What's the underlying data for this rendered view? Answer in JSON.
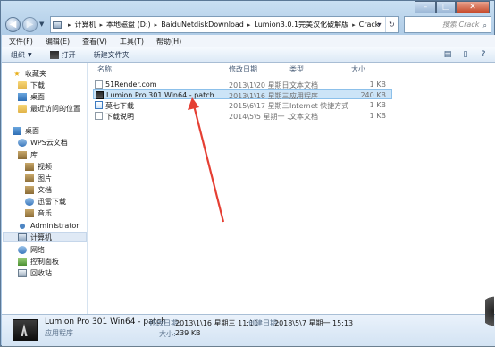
{
  "window": {
    "title_controls": {
      "minimize": "–",
      "maximize": "□",
      "close": "✕"
    }
  },
  "address_bar": {
    "crumbs": [
      "计算机",
      "本地磁盘 (D:)",
      "BaiduNetdiskDownload",
      "Lumion3.0.1完美汉化破解版",
      "Crack"
    ],
    "dropdown": "▾",
    "refresh": "↻"
  },
  "search": {
    "placeholder": "搜索 Crack",
    "icon": "search-icon"
  },
  "menu": [
    "文件(F)",
    "编辑(E)",
    "查看(V)",
    "工具(T)",
    "帮助(H)"
  ],
  "toolbar": {
    "organize": "组织",
    "open": "打开",
    "new_folder": "新建文件夹"
  },
  "nav": {
    "favorites": "收藏夹",
    "downloads": "下载",
    "desktop": "桌面",
    "recent": "最近访问的位置",
    "desktop_root": "桌面",
    "wps": "WPS云文档",
    "library": "库",
    "videos": "视频",
    "pictures": "图片",
    "documents": "文档",
    "xunlei": "迅雷下载",
    "music": "音乐",
    "admin": "Administrator",
    "computer": "计算机",
    "network": "网络",
    "control_panel": "控制面板",
    "recycle_bin": "回收站"
  },
  "columns": {
    "name": "名称",
    "date": "修改日期",
    "type": "类型",
    "size": "大小"
  },
  "files": [
    {
      "name": "51Render.com",
      "date": "2013\\1\\20 星期日 ...",
      "type": "文本文档",
      "size": "1 KB",
      "kind": "doc"
    },
    {
      "name": "Lumion Pro 301 Win64 - patch",
      "date": "2013\\1\\16 星期三 ...",
      "type": "应用程序",
      "size": "240 KB",
      "kind": "exe"
    },
    {
      "name": "莫七下载",
      "date": "2015\\6\\17 星期三 ...",
      "type": "Internet 快捷方式",
      "size": "1 KB",
      "kind": "url"
    },
    {
      "name": "下载说明",
      "date": "2014\\5\\5 星期一 ...",
      "type": "文本文档",
      "size": "1 KB",
      "kind": "doc"
    }
  ],
  "details": {
    "name": "Lumion Pro 301 Win64 - patch",
    "type": "应用程序",
    "modified_label": "修改日期:",
    "modified_value": "2013\\1\\16 星期三 11:11",
    "created_label": "创建日期:",
    "created_value": "2018\\5\\7 星期一 15:13",
    "size_label": "大小:",
    "size_value": "239 KB"
  },
  "colors": {
    "arrow": "#e53f33",
    "selection": "#cce4f7"
  }
}
